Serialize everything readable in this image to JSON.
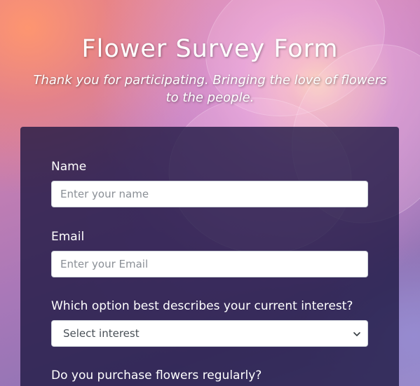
{
  "header": {
    "title": "Flower Survey Form",
    "subtitle": "Thank you for participating. Bringing the love of flowers to the people."
  },
  "form": {
    "name": {
      "label": "Name",
      "placeholder": "Enter your name",
      "value": ""
    },
    "email": {
      "label": "Email",
      "placeholder": "Enter your Email",
      "value": ""
    },
    "interest": {
      "label": "Which option best describes your current interest?",
      "selected": "Select interest",
      "icon": "chevron-down-icon"
    },
    "purchase": {
      "label": "Do you purchase flowers regularly?"
    }
  },
  "colors": {
    "card_background": "#1b1640",
    "text": "#ffffff",
    "input_border": "#ced4da"
  }
}
